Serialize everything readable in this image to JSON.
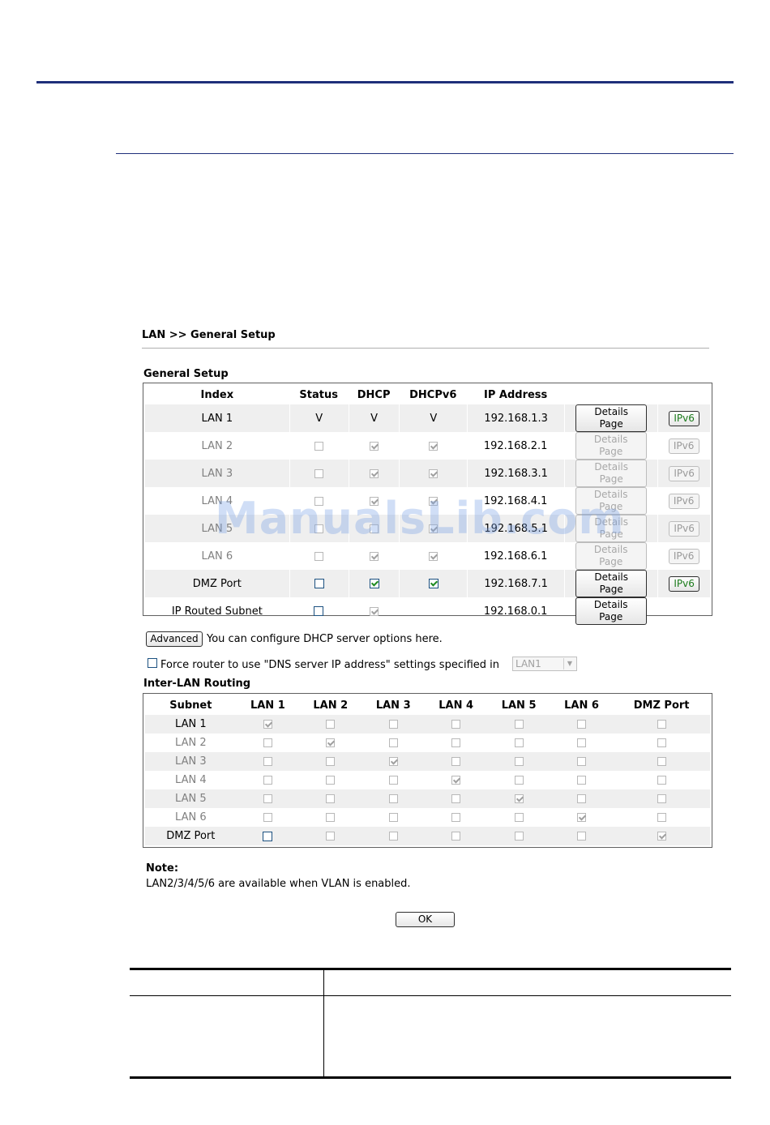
{
  "page": {
    "title": "LAN >> General Setup",
    "watermark": "ManualsLib.com"
  },
  "general_setup": {
    "section_title": "General Setup",
    "headers": [
      "Index",
      "Status",
      "DHCP",
      "DHCPv6",
      "IP Address"
    ],
    "rows": [
      {
        "index": "LAN 1",
        "status": "V",
        "dhcp": "V",
        "dhcpv6": "V",
        "ip": "192.168.1.3",
        "details": "Details Page",
        "ipv6": "IPv6"
      },
      {
        "index": "LAN 2",
        "ip": "192.168.2.1",
        "details": "Details Page",
        "ipv6": "IPv6"
      },
      {
        "index": "LAN 3",
        "ip": "192.168.3.1",
        "details": "Details Page",
        "ipv6": "IPv6"
      },
      {
        "index": "LAN 4",
        "ip": "192.168.4.1",
        "details": "Details Page",
        "ipv6": "IPv6"
      },
      {
        "index": "LAN 5",
        "ip": "192.168.5.1",
        "details": "Details Page",
        "ipv6": "IPv6"
      },
      {
        "index": "LAN 6",
        "ip": "192.168.6.1",
        "details": "Details Page",
        "ipv6": "IPv6"
      },
      {
        "index": "DMZ Port",
        "ip": "192.168.7.1",
        "details": "Details Page",
        "ipv6": "IPv6"
      },
      {
        "index": "IP Routed Subnet",
        "ip": "192.168.0.1",
        "details": "Details Page"
      }
    ]
  },
  "advanced": {
    "button_label": "Advanced",
    "text": "You can configure DHCP server options here."
  },
  "force_dns": {
    "text": "Force router to use \"DNS server IP address\" settings specified in",
    "select_value": "LAN1"
  },
  "inter_lan": {
    "section_title": "Inter-LAN Routing",
    "headers": [
      "Subnet",
      "LAN 1",
      "LAN 2",
      "LAN 3",
      "LAN 4",
      "LAN 5",
      "LAN 6",
      "DMZ Port"
    ],
    "rows": [
      "LAN 1",
      "LAN 2",
      "LAN 3",
      "LAN 4",
      "LAN 5",
      "LAN 6",
      "DMZ Port"
    ]
  },
  "note": {
    "title": "Note:",
    "text": "LAN2/3/4/5/6 are available when VLAN is enabled."
  },
  "ok_label": "OK"
}
